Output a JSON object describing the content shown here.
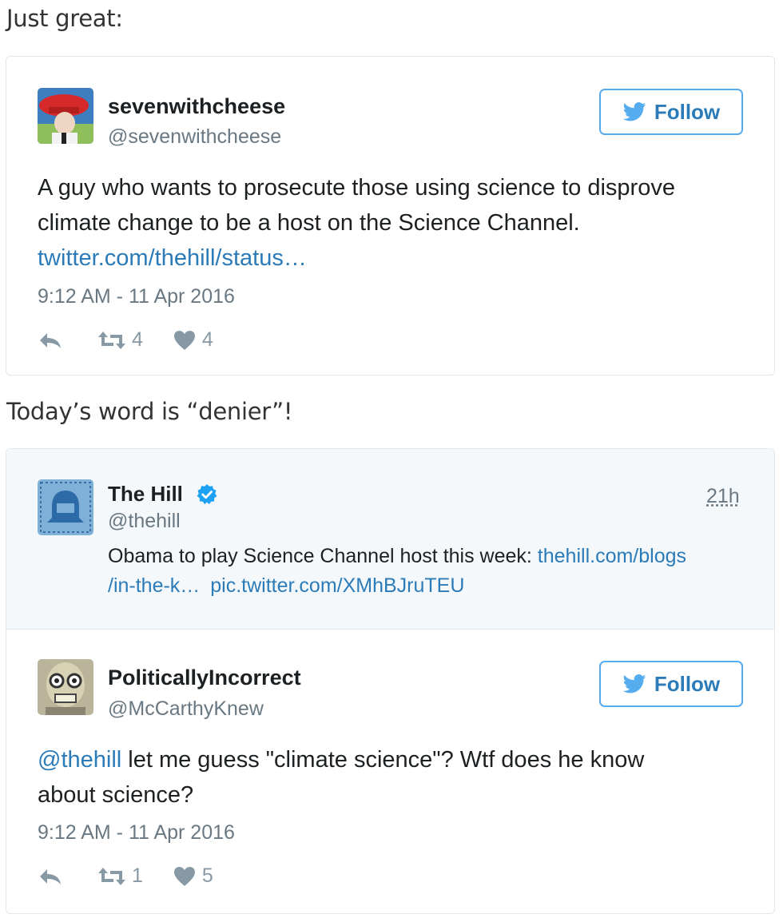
{
  "captions": {
    "first": "Just great:",
    "second": "Today’s word is “denier”!"
  },
  "tweet1": {
    "name": "sevenwithcheese",
    "handle": "@sevenwithcheese",
    "follow_label": "Follow",
    "text_line1": "A guy who wants to prosecute those using science to disprove",
    "text_line2": "climate change to be a host on the Science Channel.",
    "link": "twitter.com/thehill/status…",
    "timestamp": "9:12 AM - 11 Apr 2016",
    "retweets": "4",
    "likes": "4"
  },
  "quoted": {
    "name": "The Hill",
    "handle": "@thehill",
    "age": "21h",
    "text": "Obama to play Science Channel host this week: ",
    "link1": "thehill.com/blogs",
    "link2": "/in-the-k…",
    "link3": "pic.twitter.com/XMhBJruTEU"
  },
  "tweet2": {
    "name": "PoliticallyIncorrect",
    "handle": "@McCarthyKnew",
    "follow_label": "Follow",
    "mention": "@thehill",
    "text_line1": " let me guess \"climate science\"? Wtf does he know",
    "text_line2": "about science?",
    "timestamp": "9:12 AM - 11 Apr 2016",
    "retweets": "1",
    "likes": "5"
  },
  "colors": {
    "link": "#2b7bb9",
    "follow_border": "#55acee",
    "muted": "#697882",
    "verified": "#1da1f2"
  },
  "icons": [
    "bird-icon",
    "reply-icon",
    "retweet-icon",
    "heart-icon",
    "verified-icon"
  ]
}
